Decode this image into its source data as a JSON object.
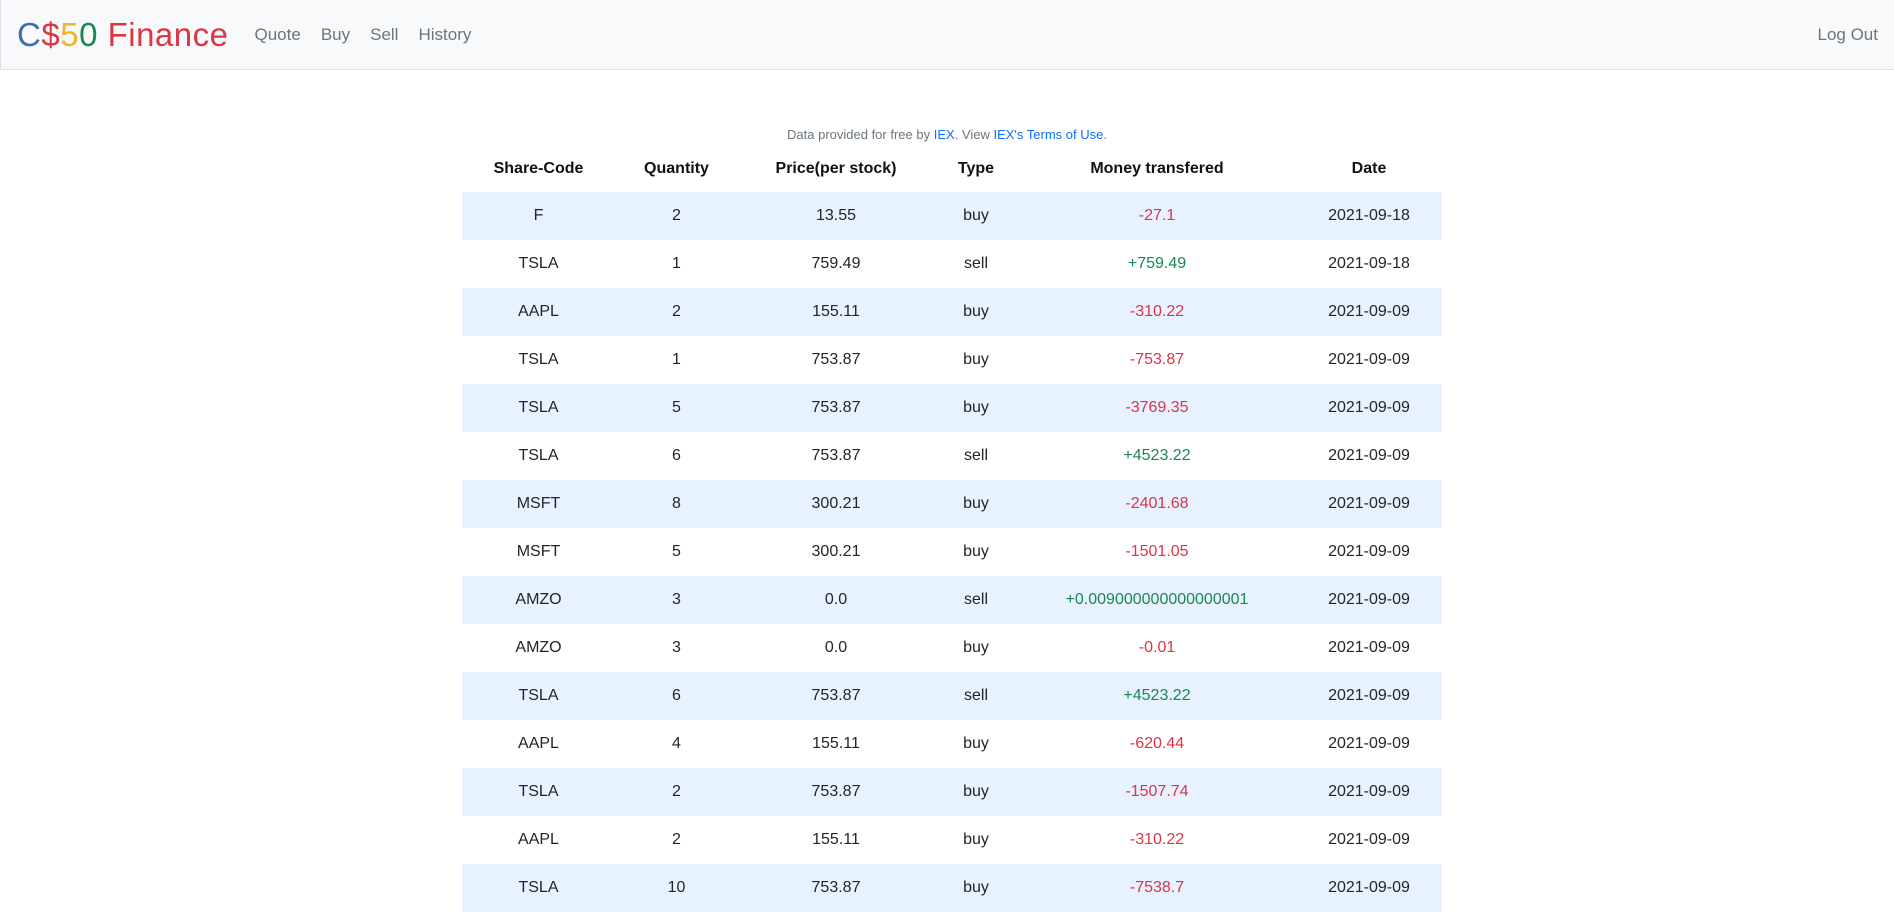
{
  "navbar": {
    "brand": [
      {
        "char": "C",
        "color": "#3d6fb6"
      },
      {
        "char": "$",
        "color": "#dc3545"
      },
      {
        "char": "5",
        "color": "#f0b429"
      },
      {
        "char": "0",
        "color": "#198754"
      },
      {
        "char": " Finance",
        "color": "#dc3545"
      }
    ],
    "links": [
      "Quote",
      "Buy",
      "Sell",
      "History"
    ],
    "logout": "Log Out"
  },
  "credit": {
    "prefix": "Data provided for free by ",
    "iex_link": "IEX",
    "middle": ". View ",
    "terms_link": "IEX's Terms of Use",
    "suffix": "."
  },
  "table": {
    "headers": [
      "Share-Code",
      "Quantity",
      "Price(per stock)",
      "Type",
      "Money transfered",
      "Date"
    ],
    "rows": [
      [
        "F",
        "2",
        "13.55",
        "buy",
        "-27.1",
        "2021-09-18"
      ],
      [
        "TSLA",
        "1",
        "759.49",
        "sell",
        "+759.49",
        "2021-09-18"
      ],
      [
        "AAPL",
        "2",
        "155.11",
        "buy",
        "-310.22",
        "2021-09-09"
      ],
      [
        "TSLA",
        "1",
        "753.87",
        "buy",
        "-753.87",
        "2021-09-09"
      ],
      [
        "TSLA",
        "5",
        "753.87",
        "buy",
        "-3769.35",
        "2021-09-09"
      ],
      [
        "TSLA",
        "6",
        "753.87",
        "sell",
        "+4523.22",
        "2021-09-09"
      ],
      [
        "MSFT",
        "8",
        "300.21",
        "buy",
        "-2401.68",
        "2021-09-09"
      ],
      [
        "MSFT",
        "5",
        "300.21",
        "buy",
        "-1501.05",
        "2021-09-09"
      ],
      [
        "AMZO",
        "3",
        "0.0",
        "sell",
        "+0.009000000000000001",
        "2021-09-09"
      ],
      [
        "AMZO",
        "3",
        "0.0",
        "buy",
        "-0.01",
        "2021-09-09"
      ],
      [
        "TSLA",
        "6",
        "753.87",
        "sell",
        "+4523.22",
        "2021-09-09"
      ],
      [
        "AAPL",
        "4",
        "155.11",
        "buy",
        "-620.44",
        "2021-09-09"
      ],
      [
        "TSLA",
        "2",
        "753.87",
        "buy",
        "-1507.74",
        "2021-09-09"
      ],
      [
        "AAPL",
        "2",
        "155.11",
        "buy",
        "-310.22",
        "2021-09-09"
      ],
      [
        "TSLA",
        "10",
        "753.87",
        "buy",
        "-7538.7",
        "2021-09-09"
      ]
    ]
  },
  "colors": {
    "negative": "#dc3545",
    "positive": "#198754",
    "row_stripe": "#e7f1ff",
    "link": "#0d6efd"
  }
}
